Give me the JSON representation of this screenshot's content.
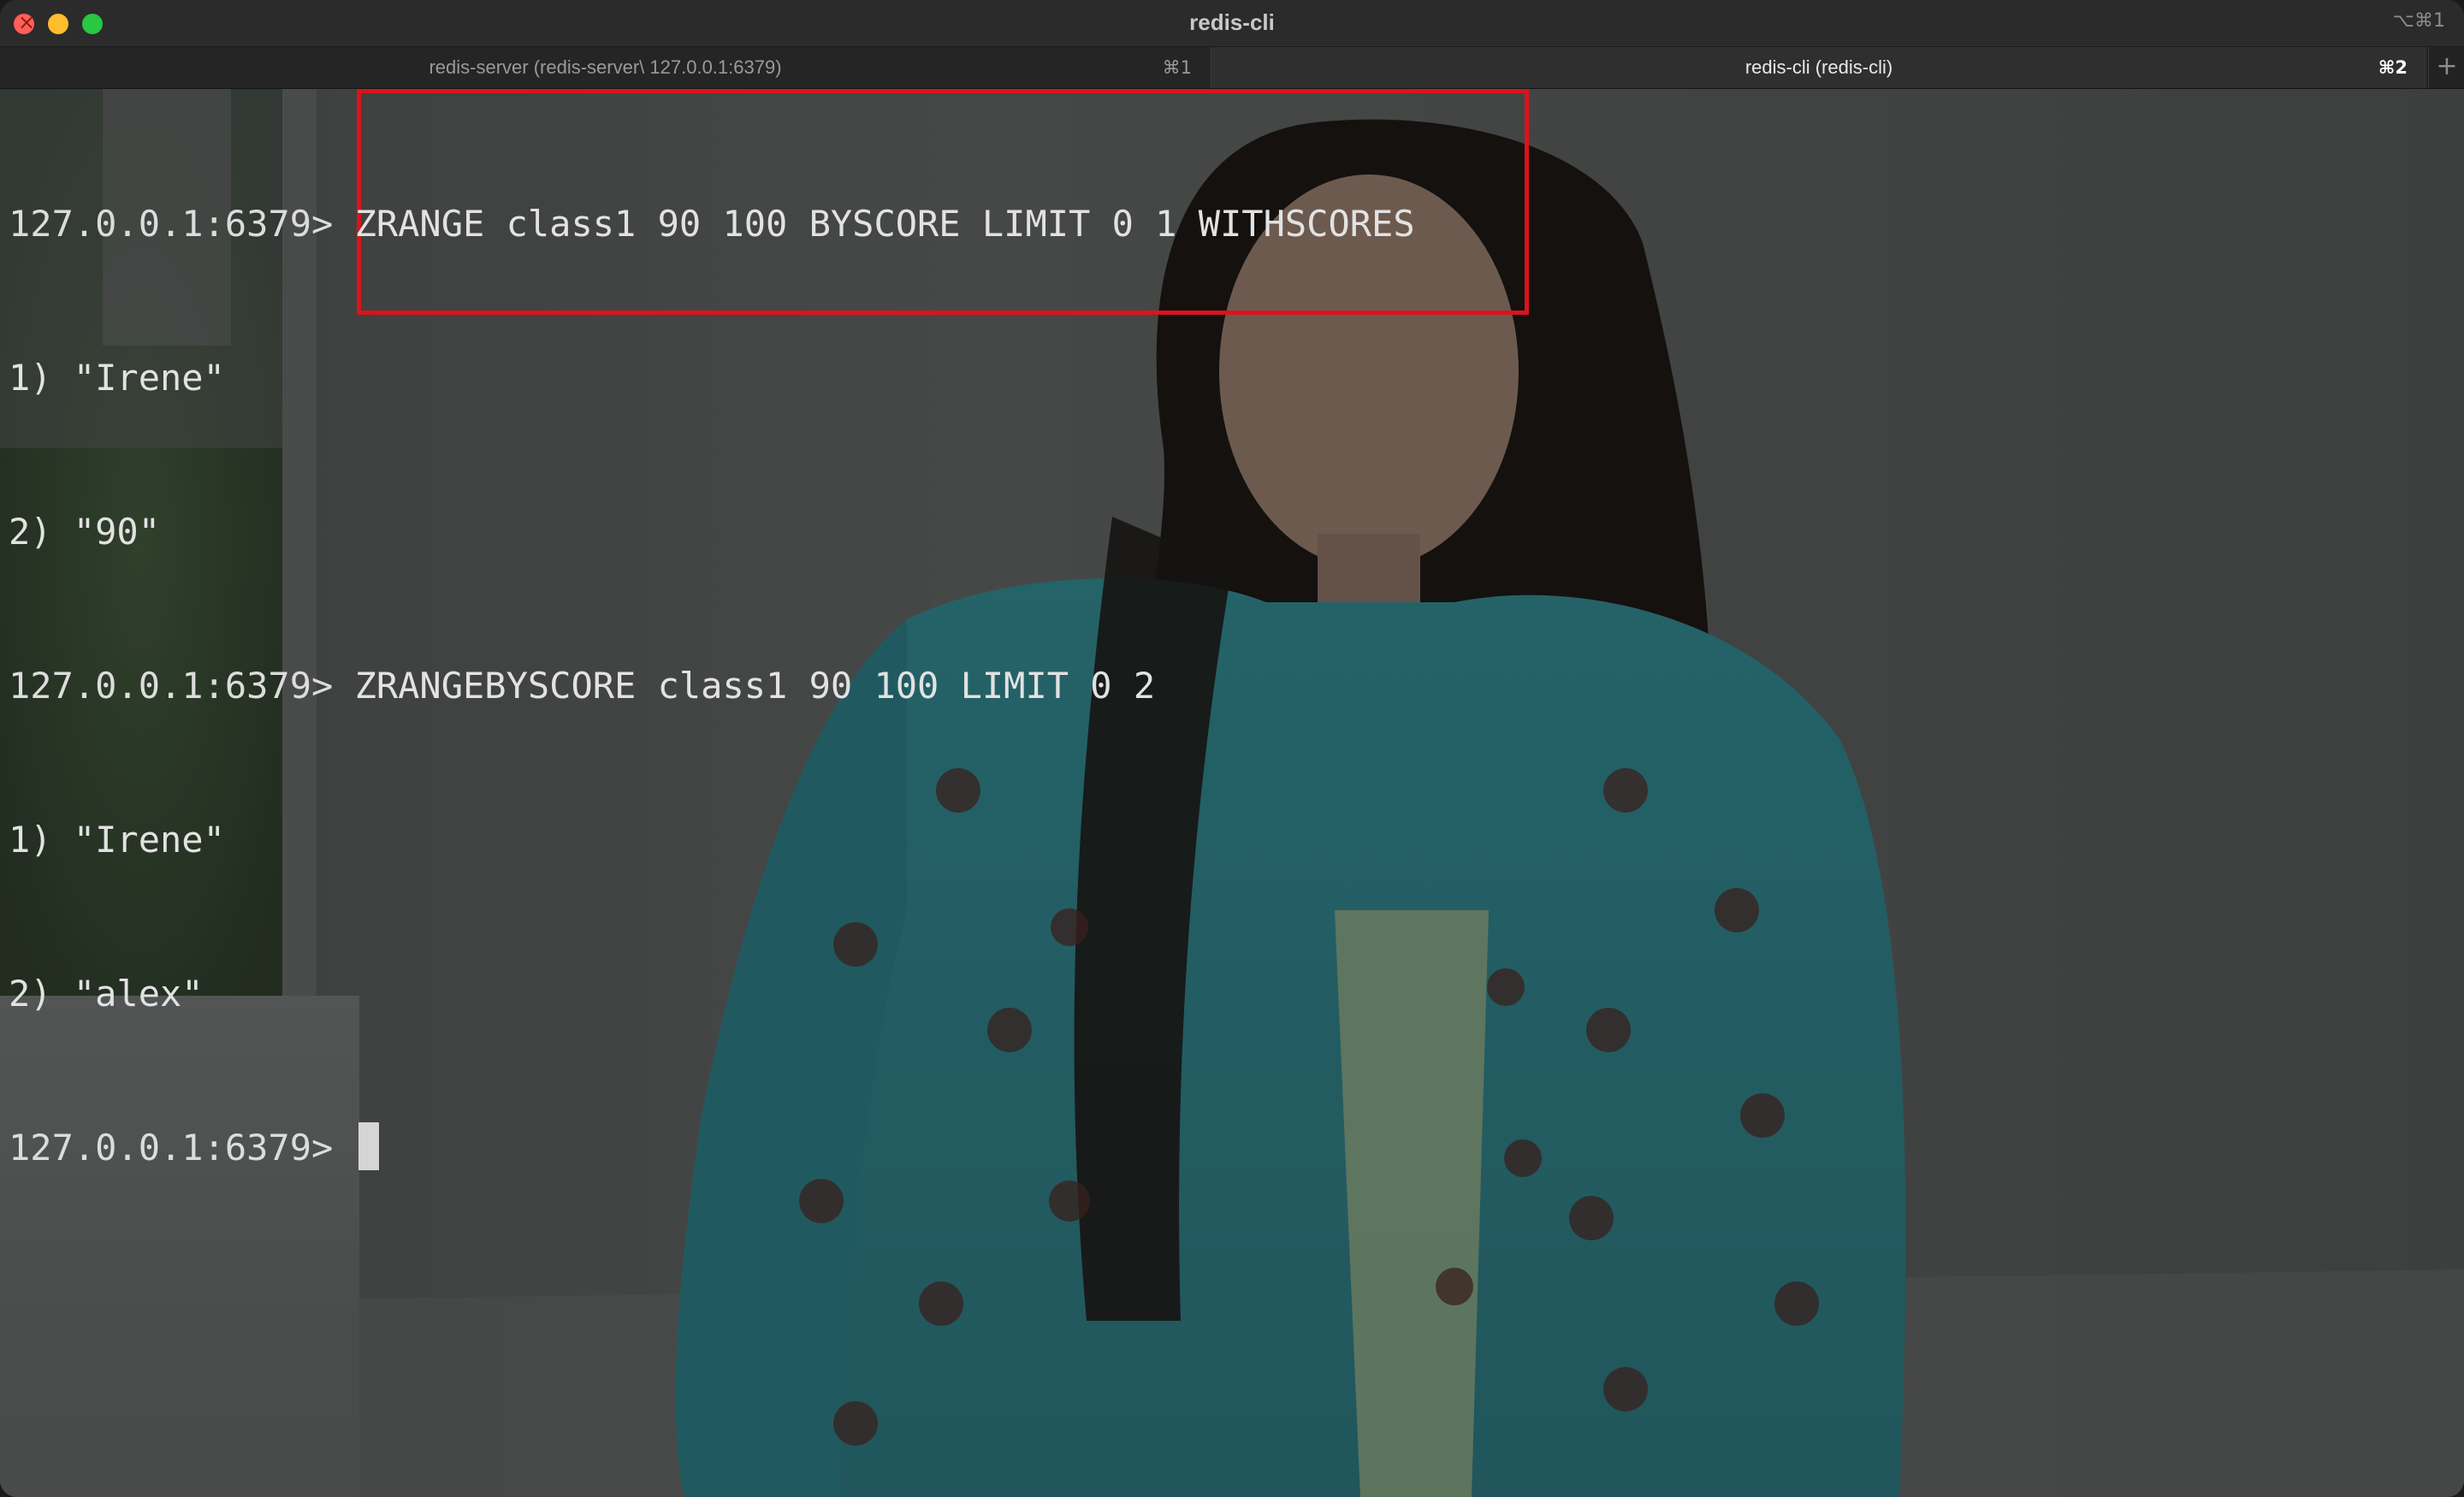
{
  "window": {
    "title": "redis-cli",
    "shortcut": "⌥⌘1"
  },
  "tabs": [
    {
      "label": "redis-server (redis-server\\ 127.0.0.1:6379)",
      "shortcut": "⌘1",
      "active": false
    },
    {
      "label": "redis-cli (redis-cli)",
      "shortcut": "⌘2",
      "active": true
    }
  ],
  "new_tab_icon": "plus-icon",
  "terminal": {
    "lines": [
      {
        "prompt": "127.0.0.1:6379> ",
        "text": "ZRANGE class1 90 100 BYSCORE LIMIT 0 1 WITHSCORES"
      },
      {
        "prompt": "",
        "text": "1) \"Irene\""
      },
      {
        "prompt": "",
        "text": "2) \"90\""
      },
      {
        "prompt": "127.0.0.1:6379> ",
        "text": "ZRANGEBYSCORE class1 90 100 LIMIT 0 2"
      },
      {
        "prompt": "",
        "text": "1) \"Irene\""
      },
      {
        "prompt": "",
        "text": "2) \"alex\""
      },
      {
        "prompt": "127.0.0.1:6379> ",
        "text": ""
      }
    ]
  },
  "colors": {
    "highlight_box": "#d9141c",
    "close": "#fe5f57",
    "minimize": "#febc2e",
    "zoom": "#28c840"
  }
}
